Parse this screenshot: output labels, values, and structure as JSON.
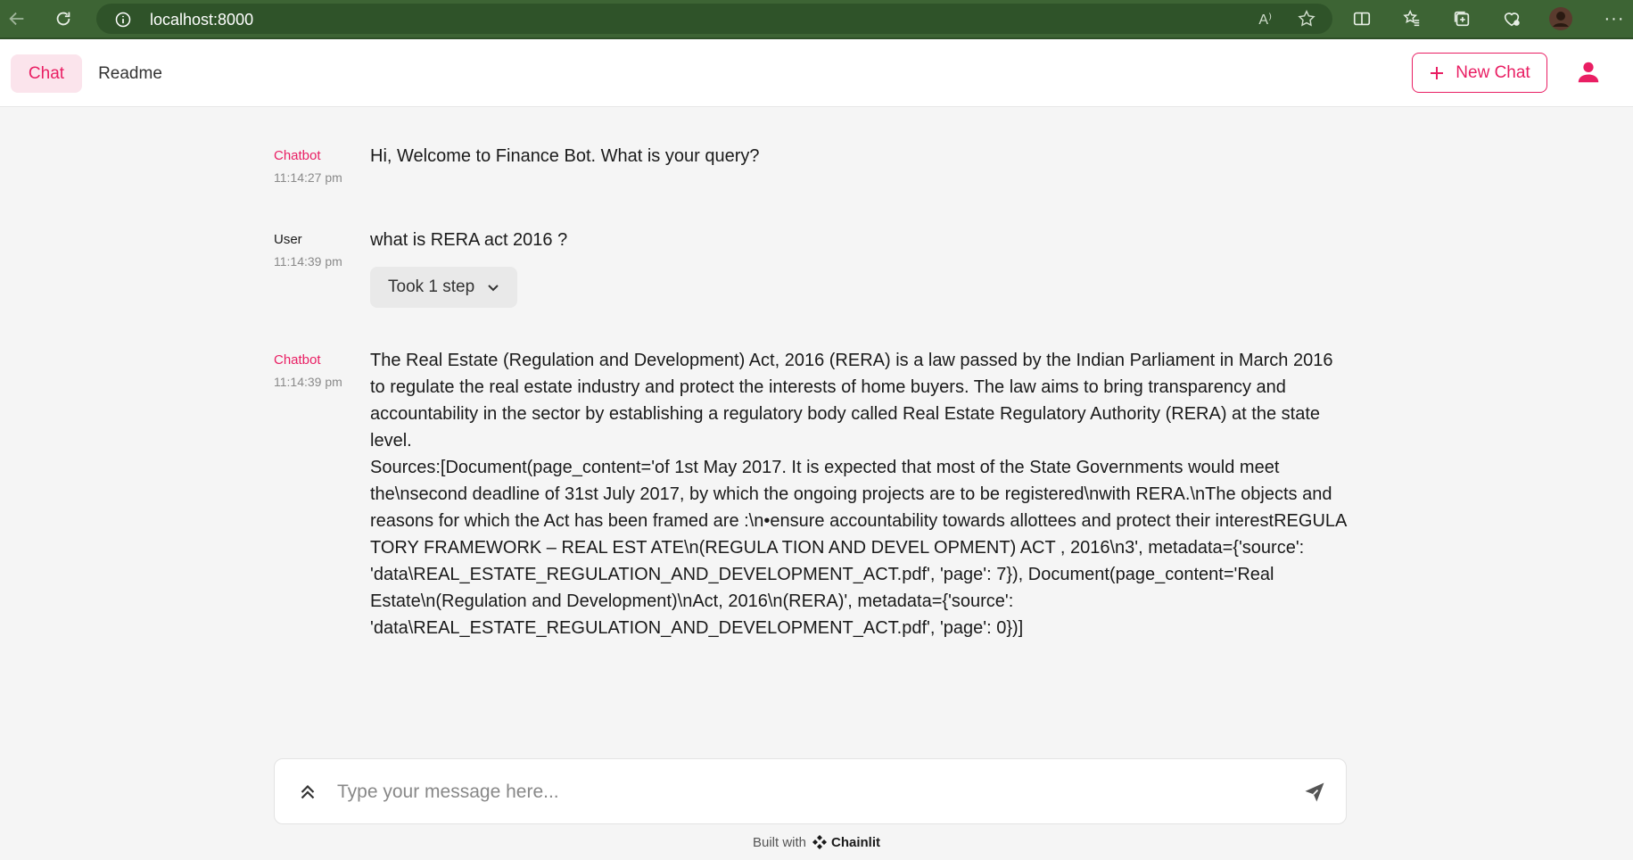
{
  "browser": {
    "url": "localhost:8000",
    "read_aloud": "A⁾"
  },
  "header": {
    "tabs": [
      {
        "label": "Chat",
        "active": true
      },
      {
        "label": "Readme",
        "active": false
      }
    ],
    "new_chat_label": "New Chat",
    "accent": "#e91e63"
  },
  "messages": [
    {
      "author": "Chatbot",
      "time": "11:14:27 pm",
      "text": "Hi, Welcome to Finance Bot. What is your query?"
    },
    {
      "author": "User",
      "time": "11:14:39 pm",
      "text": "what is RERA act 2016 ?",
      "step_label": "Took 1 step"
    },
    {
      "author": "Chatbot",
      "time": "11:14:39 pm",
      "text": "The Real Estate (Regulation and Development) Act, 2016 (RERA) is a law passed by the Indian Parliament in March 2016 to regulate the real estate industry and protect the interests of home buyers. The law aims to bring transparency and accountability in the sector by establishing a regulatory body called Real Estate Regulatory Authority (RERA) at the state level.\nSources:[Document(page_content='of 1st May 2017. It is expected that most of the State Governments would meet the\\nsecond deadline of 31st July 2017, by which the ongoing projects are to be registered\\nwith RERA.\\nThe objects and reasons for which the Act has been framed are :\\n•ensure accountability towards allottees and protect their interestREGULA TORY FRAMEWORK – REAL EST ATE\\n(REGULA TION AND DEVEL OPMENT) ACT , 2016\\n3', metadata={'source': 'data\\REAL_ESTATE_REGULATION_AND_DEVELOPMENT_ACT.pdf', 'page': 7}), Document(page_content='Real Estate\\n(Regulation and Development)\\nAct, 2016\\n(RERA)', metadata={'source': 'data\\REAL_ESTATE_REGULATION_AND_DEVELOPMENT_ACT.pdf', 'page': 0})]"
    }
  ],
  "composer": {
    "placeholder": "Type your message here..."
  },
  "footer": {
    "built_with": "Built with",
    "brand": "Chainlit"
  }
}
